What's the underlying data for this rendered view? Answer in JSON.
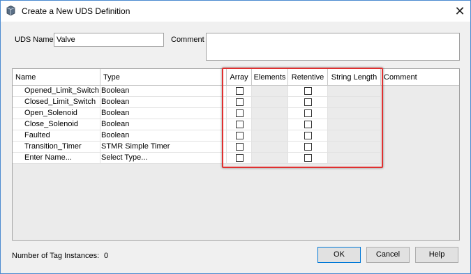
{
  "window": {
    "title": "Create a New UDS Definition",
    "close_glyph": "✕"
  },
  "form": {
    "uds_name_label": "UDS Name",
    "uds_name_value": "Valve",
    "comment_label": "Comment",
    "comment_value": ""
  },
  "grid": {
    "headers": {
      "name": "Name",
      "type": "Type",
      "array": "Array",
      "elements": "Elements",
      "retentive": "Retentive",
      "string_length": "String Length",
      "comment": "Comment"
    },
    "rows": [
      {
        "name": "Opened_Limit_Switch",
        "type": "Boolean",
        "array": false,
        "retentive": false
      },
      {
        "name": "Closed_Limit_Switch",
        "type": "Boolean",
        "array": false,
        "retentive": false
      },
      {
        "name": "Open_Solenoid",
        "type": "Boolean",
        "array": false,
        "retentive": false
      },
      {
        "name": "Close_Solenoid",
        "type": "Boolean",
        "array": false,
        "retentive": false
      },
      {
        "name": "Faulted",
        "type": "Boolean",
        "array": false,
        "retentive": false
      },
      {
        "name": "Transition_Timer",
        "type": "STMR  Simple Timer",
        "array": false,
        "retentive": false
      },
      {
        "name": "Enter Name...",
        "type": "Select Type...",
        "array": false,
        "retentive": false
      }
    ]
  },
  "footer": {
    "instances_label": "Number of Tag Instances:",
    "instances_value": "0",
    "ok": "OK",
    "cancel": "Cancel",
    "help": "Help"
  },
  "colors": {
    "highlight": "#e03030",
    "window_border": "#4a8ad0",
    "default_button_border": "#0078d7"
  },
  "icons": {
    "title": "uds-definition-icon",
    "close": "close-icon"
  }
}
